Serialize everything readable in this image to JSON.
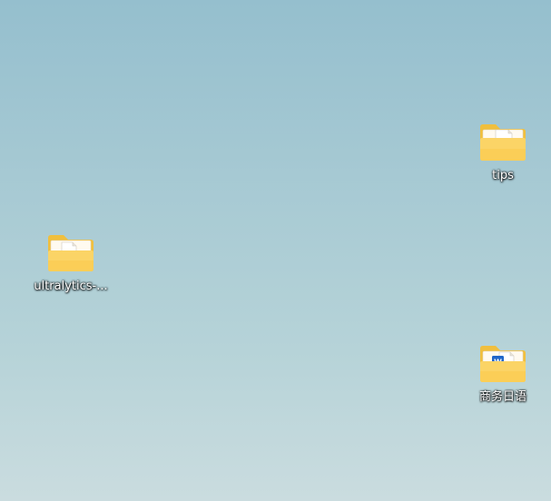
{
  "desktop": {
    "icons": [
      {
        "label": "tips",
        "icon": "folder-with-document-icon"
      },
      {
        "label": "ultralytics-...",
        "icon": "folder-with-document-icon"
      },
      {
        "label": "商务日语",
        "icon": "folder-with-word-document-icon"
      }
    ]
  },
  "colors": {
    "folder_back": "#f3c54c",
    "folder_front": "#fbd668",
    "folder_front_light": "#ffe496",
    "word_blue": "#1f66c9"
  }
}
